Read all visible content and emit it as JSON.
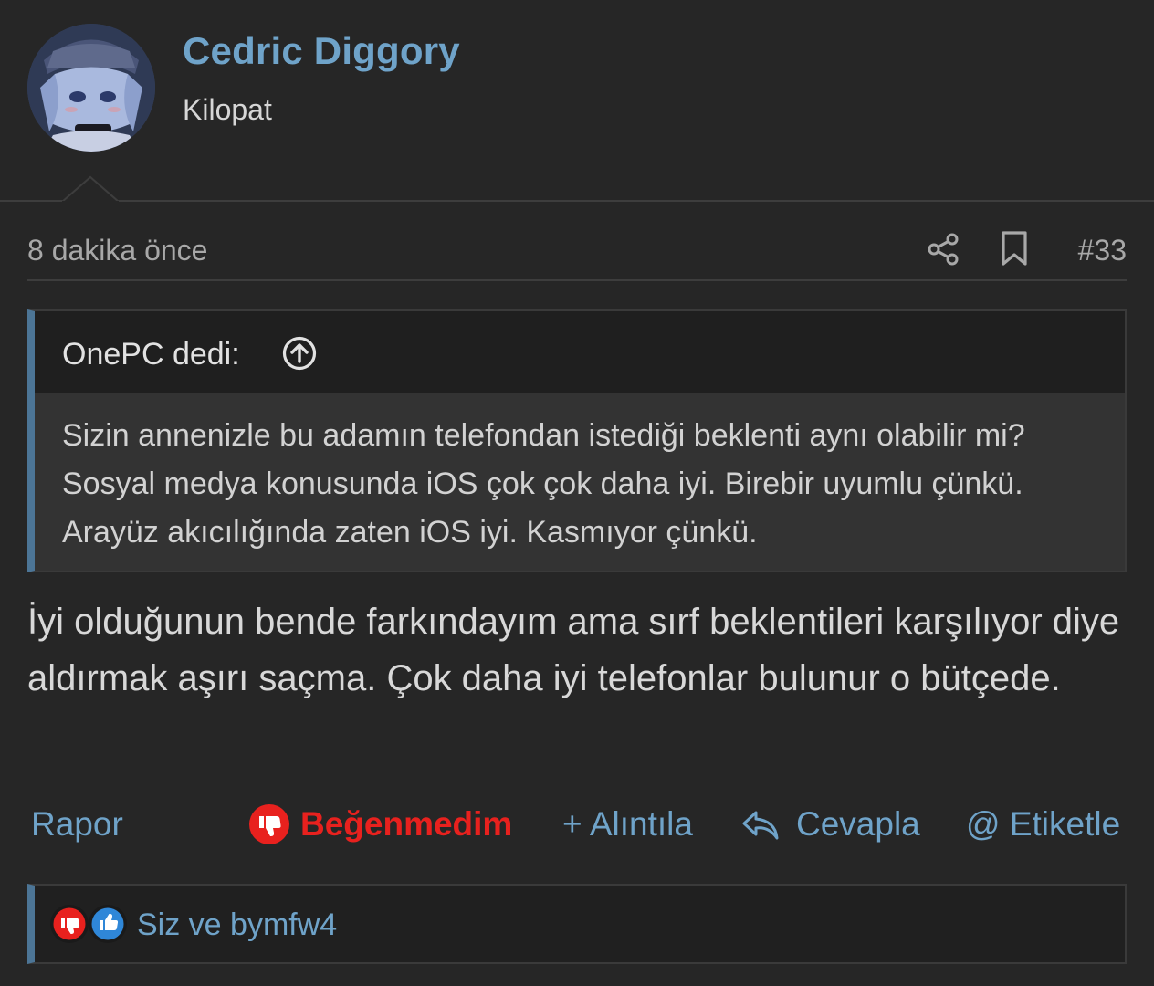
{
  "user": {
    "name": "Cedric Diggory",
    "title": "Kilopat"
  },
  "meta": {
    "time": "8 dakika önce",
    "post_number": "#33",
    "icons": [
      "share-icon",
      "bookmark-icon"
    ]
  },
  "quote": {
    "author": "OnePC dedi:",
    "text": "Sizin annenizle bu adamın telefondan istediği beklenti aynı olabilir mi? Sosyal medya konusunda iOS çok çok daha iyi. Birebir uyumlu çünkü. Arayüz akıcılığında zaten iOS iyi. Kasmıyor çünkü."
  },
  "message": "İyi olduğunun bende farkındayım ama sırf beklentileri karşılıyor diye aldırmak aşırı saçma. Çok daha iyi telefonlar bulunur o bütçede.",
  "actions": {
    "report": "Rapor",
    "dislike": "Beğenmedim",
    "quote": "+ Alıntıla",
    "reply": "Cevapla",
    "tag": "@ Etiketle"
  },
  "reactions": {
    "text": "Siz ve bymfw4"
  },
  "colors": {
    "background": "#262626",
    "link": "#6fa3c9",
    "dislike": "#e8211e",
    "quote_accent": "#4c7596"
  }
}
